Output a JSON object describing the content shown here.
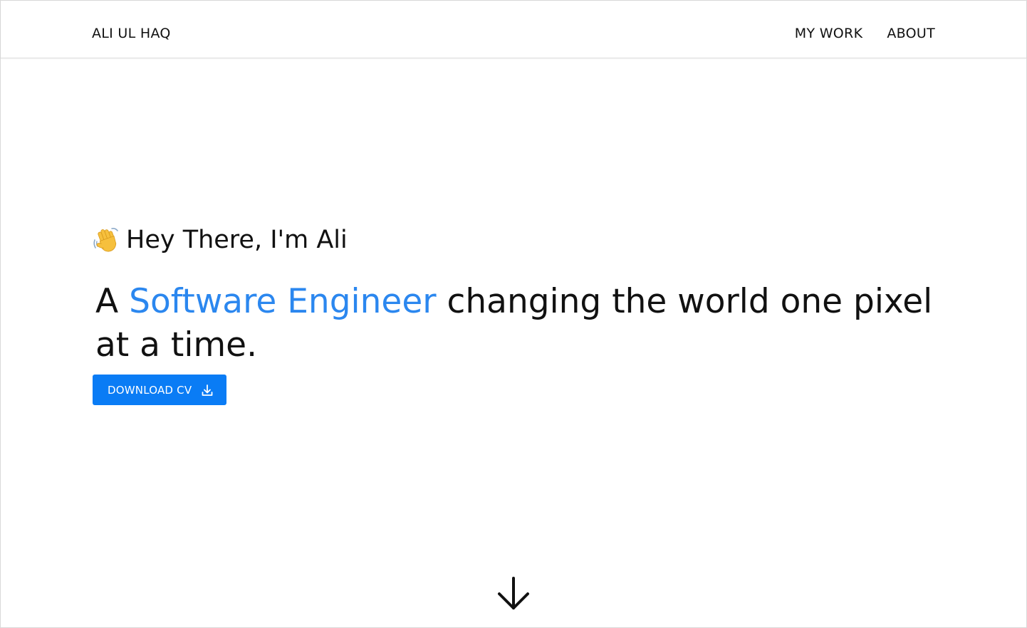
{
  "navbar": {
    "brand": "ALI UL HAQ",
    "links": [
      {
        "label": "MY WORK"
      },
      {
        "label": "ABOUT"
      }
    ]
  },
  "hero": {
    "greeting_icon": "waving-hand-icon",
    "greeting": "Hey There, I'm Ali",
    "headline_prefix": "A",
    "headline_accent": "Software Engineer",
    "headline_suffix": "changing the world one pixel at a time.",
    "cv_button_label": "DOWNLOAD CV",
    "cv_button_icon": "download-icon",
    "scroll_icon": "arrow-down-icon"
  },
  "colors": {
    "accent": "#2b87ef",
    "button": "#0a7cf5",
    "text": "#111111"
  }
}
